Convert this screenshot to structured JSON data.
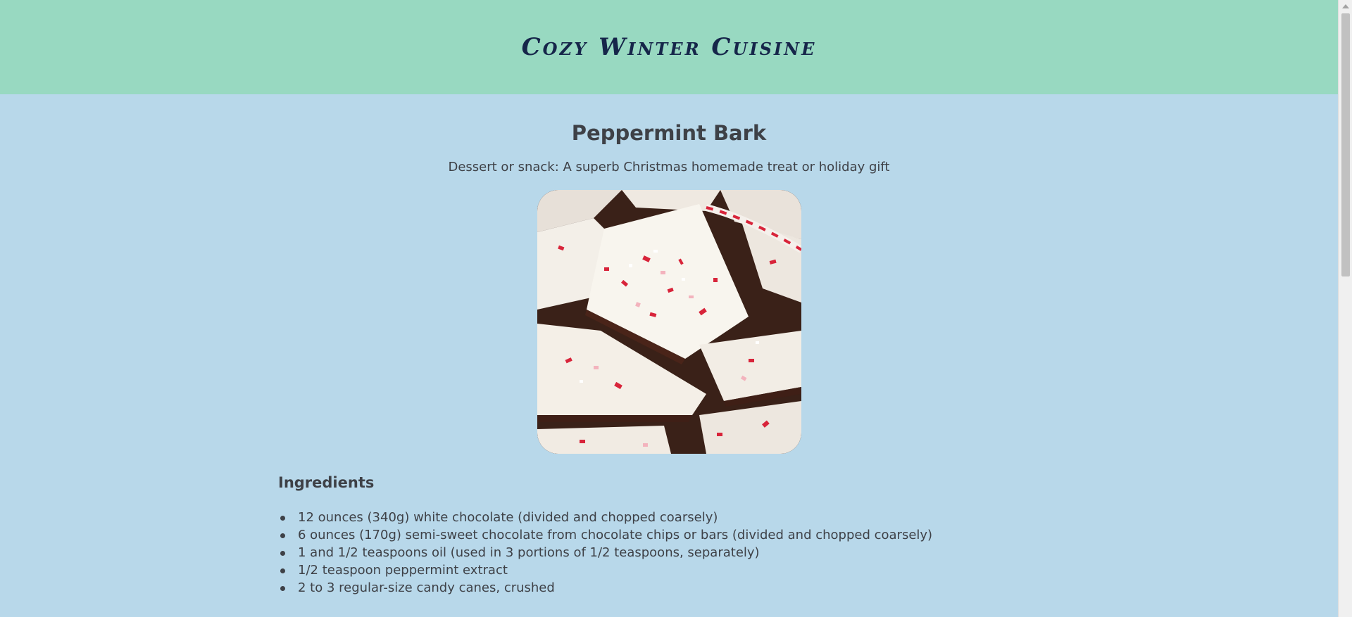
{
  "header": {
    "site_title": "Cozy Winter Cuisine"
  },
  "recipe": {
    "title": "Peppermint Bark",
    "subtitle": "Dessert or snack: A superb Christmas homemade treat or holiday gift",
    "image_alt": "Peppermint bark"
  },
  "ingredients": {
    "heading": "Ingredients",
    "items": [
      "12 ounces (340g) white chocolate (divided and chopped coarsely)",
      "6 ounces (170g) semi-sweet chocolate from chocolate chips or bars (divided and chopped coarsely)",
      "1 and 1/2 teaspoons oil (used in 3 portions of 1/2 teaspoons, separately)",
      "1/2 teaspoon peppermint extract",
      "2 to 3 regular-size candy canes, crushed"
    ]
  },
  "colors": {
    "header_bg": "#98d9c1",
    "page_bg": "#b8d8ea",
    "title_color": "#16264a",
    "text_color": "#3e4147"
  }
}
